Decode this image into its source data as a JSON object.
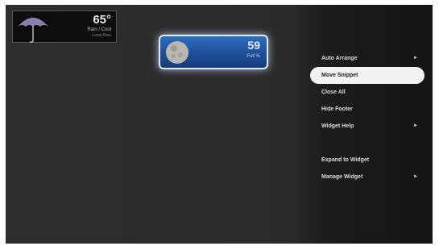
{
  "weather_snippet": {
    "temperature": "65°",
    "condition": "Rain / Cool",
    "location": "Local Area",
    "icon": "umbrella-icon"
  },
  "moon_snippet": {
    "value": "59",
    "label": "Full %",
    "icon": "moon-icon"
  },
  "menu": {
    "items": [
      {
        "label": "Auto Arrange",
        "has_submenu": true
      },
      {
        "label": "Move Snippet",
        "selected": true
      },
      {
        "label": "Close All"
      },
      {
        "label": "Hide Footer"
      },
      {
        "label": "Widget Help",
        "has_submenu": true
      }
    ],
    "items2": [
      {
        "label": "Expand to Widget"
      },
      {
        "label": "Manage Widget",
        "has_submenu": true
      }
    ],
    "submenu_glyph": "►"
  }
}
